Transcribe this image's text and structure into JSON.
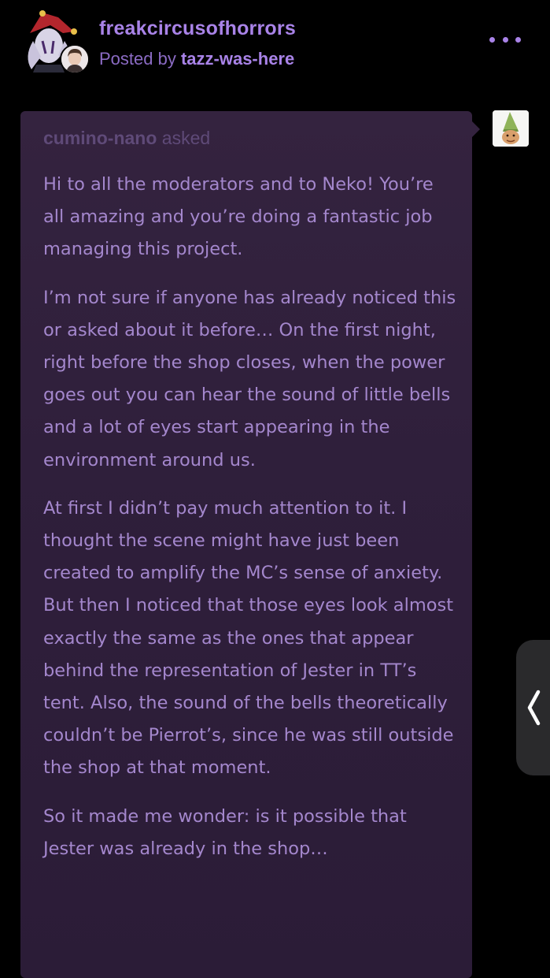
{
  "post": {
    "blog_name": "freakcircusofhorrors",
    "posted_by_prefix": "Posted by ",
    "posted_by_user": "tazz-was-here",
    "more_icon": "more-dots-icon"
  },
  "ask": {
    "asker": "cumino-nano",
    "asked_suffix": " asked",
    "paragraphs": [
      "Hi to all the moderators and to Neko! You’re all amazing and you’re doing a fantastic job managing this project.",
      "I’m not sure if anyone has already noticed this or asked about it before… On the first night, right before the shop closes, when the power goes out you can hear the sound of little bells and a lot of eyes start appearing in the environment around us.",
      "At first I didn’t pay much attention to it. I thought the scene might have just been created to amplify the MC’s sense of anxiety. But then I noticed that those eyes look almost exactly the same as the ones that appear behind the representation of Jester in TT’s tent. Also, the sound of the bells theoretically couldn’t be Pierrot’s, since he was still outside the shop at that moment.",
      "So it made me wonder: is it possible that Jester was already in the shop…"
    ]
  },
  "colors": {
    "background": "#000000",
    "accent": "#a983e8",
    "ask_background": "#34233f",
    "ask_text": "#a487cd"
  },
  "side_handle": {
    "icon": "chevron-left-icon"
  }
}
